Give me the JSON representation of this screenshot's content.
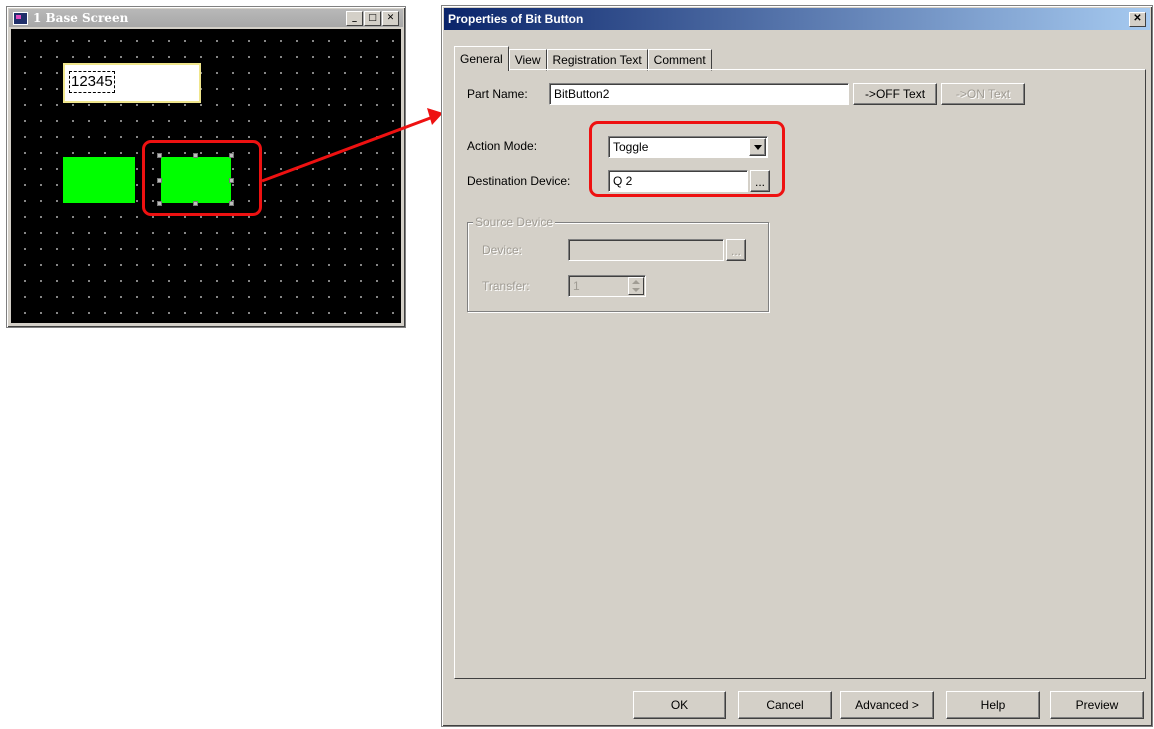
{
  "base_screen": {
    "title": "1  Base Screen",
    "number_display": "12345"
  },
  "dialog": {
    "title": "Properties of Bit Button",
    "tabs": [
      {
        "label": "General",
        "active": true
      },
      {
        "label": "View",
        "active": false
      },
      {
        "label": "Registration Text",
        "active": false
      },
      {
        "label": "Comment",
        "active": false
      }
    ],
    "part_name_label": "Part Name:",
    "part_name_value": "BitButton2",
    "off_text_button": "->OFF Text",
    "on_text_button": "->ON Text",
    "action_mode_label": "Action Mode:",
    "action_mode_value": "Toggle",
    "destination_device_label": "Destination Device:",
    "destination_device_value": "Q 2",
    "browse_button": "...",
    "source_device_group": "Source Device",
    "device_label": "Device:",
    "device_value": "",
    "transfer_label": "Transfer:",
    "transfer_value": "1",
    "footer_buttons": {
      "ok": "OK",
      "cancel": "Cancel",
      "advanced": "Advanced >",
      "help": "Help",
      "preview": "Preview"
    }
  },
  "colors": {
    "annotation": "#ee1111",
    "lamp": "#00ff00",
    "titlebar_start": "#0a246a",
    "titlebar_end": "#a6caf0"
  }
}
